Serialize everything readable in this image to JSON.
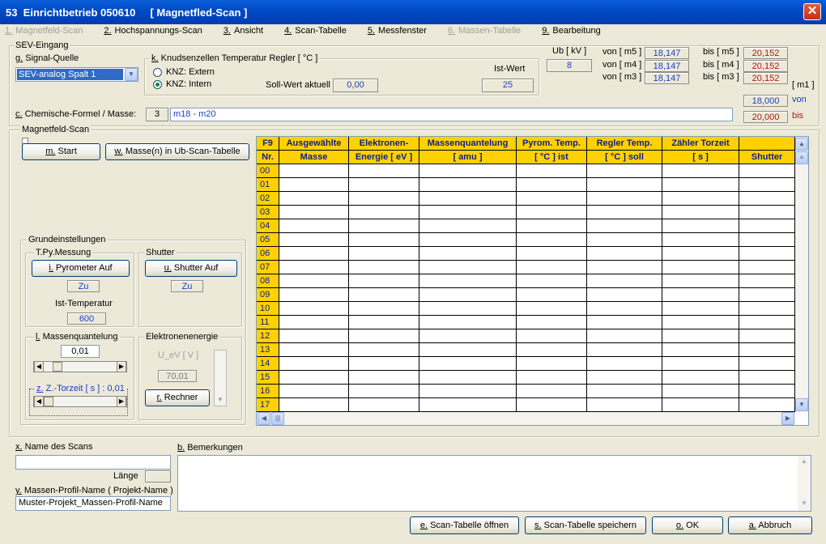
{
  "window": {
    "title": "53  Einrichtbetrieb 050610     [ Magnetfled-Scan ]"
  },
  "menu": [
    {
      "num": "1.",
      "label": "Magnetfeld-Scan",
      "disabled": true
    },
    {
      "num": "2.",
      "label": "Hochspannungs-Scan",
      "disabled": false
    },
    {
      "num": "3.",
      "label": "Ansicht",
      "disabled": false
    },
    {
      "num": "4.",
      "label": "Scan-Tabelle",
      "disabled": false
    },
    {
      "num": "5.",
      "label": "Messfenster",
      "disabled": false
    },
    {
      "num": "6.",
      "label": "Massen-Tabelle",
      "disabled": true
    },
    {
      "num": "9.",
      "label": "Bearbeitung",
      "disabled": false
    }
  ],
  "sev": {
    "group_label": "SEV-Eingang",
    "signal_label_key": "g.",
    "signal_label": "Signal-Quelle",
    "signal_value": "SEV-analog Spalt 1",
    "knz": {
      "group_key": "k.",
      "group_label": "Knudsenzellen Temperatur Regler  [ °C ]",
      "opt_extern": "KNZ: Extern",
      "opt_intern": "KNZ: Intern",
      "istwert_label": "Ist-Wert",
      "sollwert_label": "Soll-Wert aktuell",
      "sollwert_value": "0,00",
      "istwert_value": "25"
    },
    "ub_label": "Ub [ kV ]",
    "ub_value": "8",
    "von_m5_label": "von [ m5 ]",
    "von_m5": "18,147",
    "von_m4_label": "von [ m4 ]",
    "von_m4": "18,147",
    "von_m3_label": "von [ m3 ]",
    "von_m3": "18,147",
    "bis_m5_label": "bis [ m5 ]",
    "bis_m5": "20,152",
    "bis_m4_label": "bis [ m4 ]",
    "bis_m4": "20,152",
    "bis_m3_label": "bis [ m3 ]",
    "bis_m3": "20,152",
    "m1_label": "[ m1 ]",
    "m1_von_value": "18,000",
    "m1_von_label": "von",
    "m1_bis_value": "20,000",
    "m1_bis_label": "bis",
    "formel_key": "c.",
    "formel_label": "Chemische-Formel / Masse:",
    "formel_count": "3",
    "formel_value": "m18 - m20"
  },
  "scan": {
    "group_label": "Magnetfeld-Scan",
    "start_key": "m.",
    "start_label": "Start",
    "massen_key": "w.",
    "massen_label": "Masse(n) in Ub-Scan-Tabelle"
  },
  "grund": {
    "group_label": "Grundeinstellungen",
    "tpy_label": "T.Py.Messung",
    "pyro_key": "i.",
    "pyro_label": "Pyrometer Auf",
    "pyro_state": "Zu",
    "ist_temp_label": "Ist-Temperatur",
    "ist_temp_value": "600",
    "shutter_label": "Shutter",
    "shutter_key": "u.",
    "shutter_btn": "Shutter Auf",
    "shutter_state": "Zu",
    "massenq_key": "l.",
    "massenq_label": "Massenquantelung",
    "massenq_value": "0,01",
    "ztorzeit_key": "z.",
    "ztorzeit_label": "Z.-Torzeit [ s ] : 0,01",
    "elek_label": "Elektronenenergie",
    "ueV_label": "U_eV [ V ]",
    "ueV_value": "70,01",
    "rechner_key": "r.",
    "rechner_label": "Rechner"
  },
  "table": {
    "corner_top": "F9",
    "corner_bottom": "Nr.",
    "columns": [
      {
        "top": "Ausgewählte",
        "bottom": "Masse"
      },
      {
        "top": "Elektronen-",
        "bottom": "Energie [ eV ]"
      },
      {
        "top": "Massenquantelung",
        "bottom": "[ amu ]"
      },
      {
        "top": "Pyrom. Temp.",
        "bottom": "[ °C ] ist"
      },
      {
        "top": "Regler Temp.",
        "bottom": "[ °C ] soll"
      },
      {
        "top": "Zähler Torzeit",
        "bottom": "[ s ]"
      },
      {
        "top": "",
        "bottom": "Shutter"
      }
    ],
    "rows": [
      "00",
      "01",
      "02",
      "03",
      "04",
      "05",
      "06",
      "07",
      "08",
      "09",
      "10",
      "11",
      "12",
      "13",
      "14",
      "15",
      "16",
      "17"
    ]
  },
  "bottom": {
    "name_key": "x.",
    "name_label": "Name des Scans",
    "name_value": "",
    "laenge_label": "Länge",
    "profil_key": "y.",
    "profil_label": "Massen-Profil-Name ( Projekt-Name )",
    "profil_value": "Muster-Projekt_Massen-Profil-Name",
    "bem_key": "b.",
    "bem_label": "Bemerkungen",
    "btn_open_key": "e.",
    "btn_open": "Scan-Tabelle öffnen",
    "btn_save_key": "s.",
    "btn_save": "Scan-Tabelle speichern",
    "btn_ok_key": "o.",
    "btn_ok": "OK",
    "btn_abort_key": "a.",
    "btn_abort": "Abbruch"
  }
}
